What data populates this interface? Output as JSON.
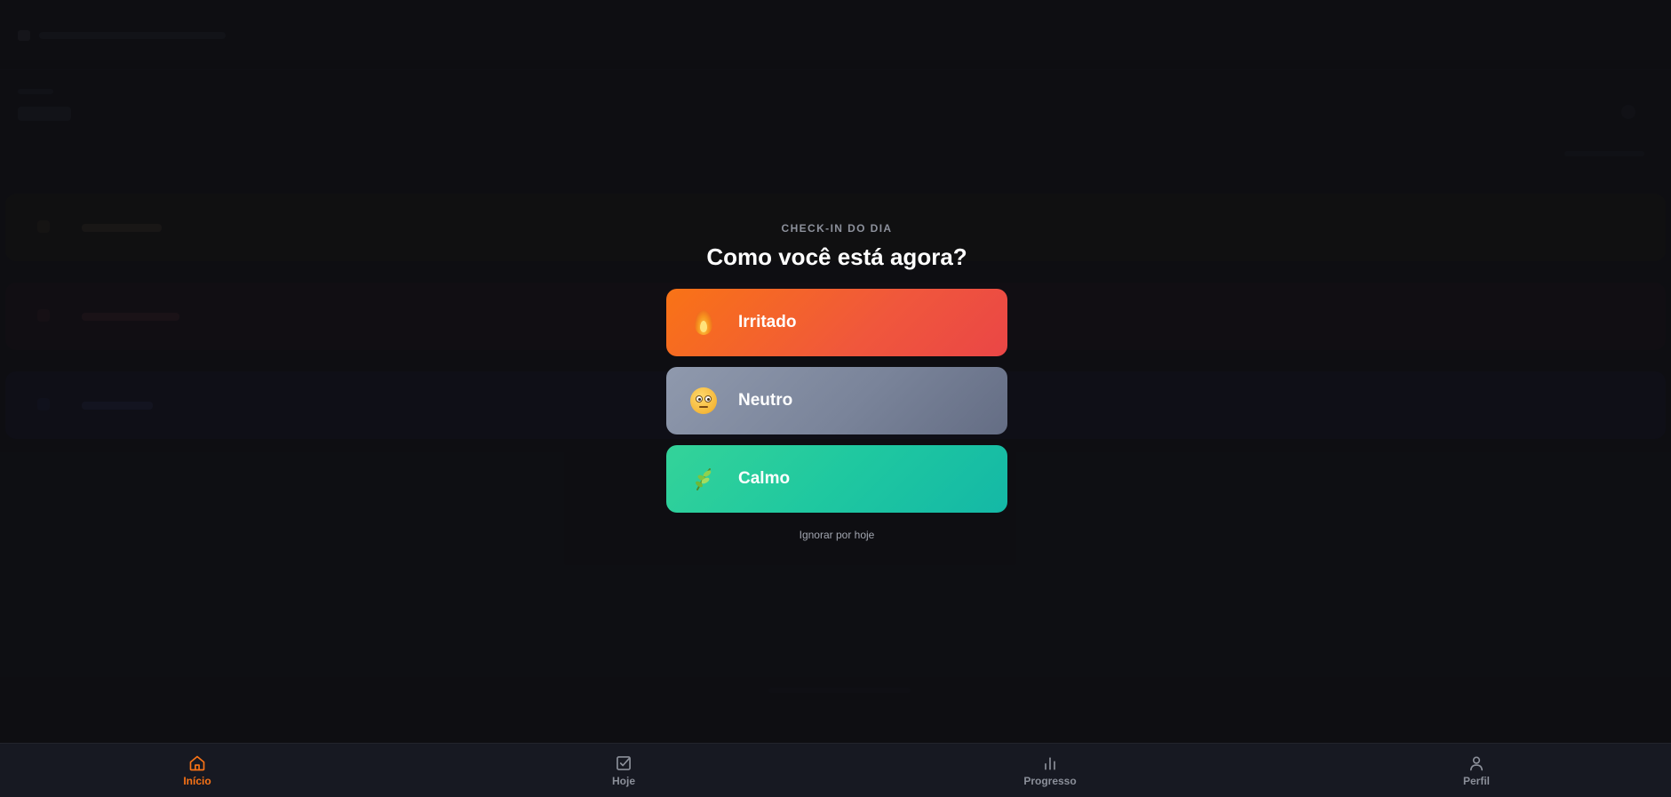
{
  "modal": {
    "eyebrow": "CHECK-IN DO DIA",
    "question": "Como você está agora?",
    "options": [
      {
        "label": "Irritado",
        "icon": "fire-icon"
      },
      {
        "label": "Neutro",
        "icon": "neutral-face-icon"
      },
      {
        "label": "Calmo",
        "icon": "herb-icon"
      }
    ],
    "skip_label": "Ignorar por hoje"
  },
  "nav": {
    "items": [
      {
        "label": "Início",
        "icon": "home-icon",
        "active": true
      },
      {
        "label": "Hoje",
        "icon": "checkbox-icon",
        "active": false
      },
      {
        "label": "Progresso",
        "icon": "bar-chart-icon",
        "active": false
      },
      {
        "label": "Perfil",
        "icon": "user-icon",
        "active": false
      }
    ]
  },
  "colors": {
    "accent": "#f97316",
    "irritated": "#f0573c",
    "neutral": "#7a849a",
    "calm": "#1fc8a0",
    "nav_inactive": "#8b8f99"
  }
}
